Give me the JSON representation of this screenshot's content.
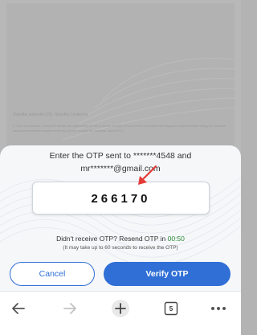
{
  "background": {
    "text_line": "Standby authority (20). Standby Limited ta",
    "text_paragraph": "2. I/we my Aadhaar / Virtual ID details (as applicable) for the purpose of eKyc of documents requested with signature authentication using the Aadhaar based authentication system with my identity through the Aadhaar based KYC"
  },
  "otp_sheet": {
    "message_line1": "Enter the OTP sent to *******4548 and",
    "message_line2": "mr*******@gmail.com",
    "otp_value": "266170",
    "resend_prefix": "Didn't receive OTP? Resend OTP in ",
    "timer": "00:50",
    "note": "(It may take up to 60 seconds to receive the OTP)",
    "cancel_label": "Cancel",
    "verify_label": "Verify OTP"
  },
  "browser_nav": {
    "tab_count": "5"
  },
  "colors": {
    "accent": "#2f6fd6",
    "timer": "#2e8b3a",
    "arrow": "#e53935"
  }
}
